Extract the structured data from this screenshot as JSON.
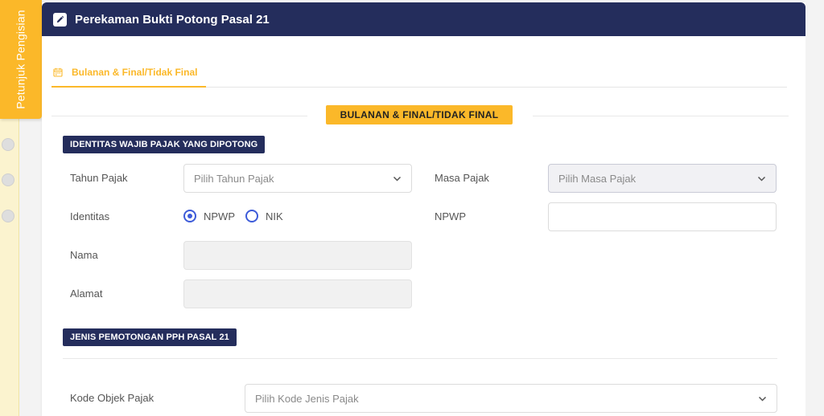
{
  "side_tab": {
    "label": "Petunjuk Pengisian"
  },
  "header": {
    "title": "Perekaman Bukti Potong Pasal 21"
  },
  "tabs": [
    {
      "label": "Bulanan & Final/Tidak Final",
      "active": true
    }
  ],
  "section": {
    "title": "BULANAN & FINAL/TIDAK FINAL"
  },
  "identitas_group": {
    "title": "IDENTITAS WAJIB PAJAK YANG DIPOTONG",
    "tahun_pajak": {
      "label": "Tahun Pajak",
      "placeholder": "Pilih Tahun Pajak"
    },
    "masa_pajak": {
      "label": "Masa Pajak",
      "placeholder": "Pilih Masa Pajak"
    },
    "identitas": {
      "label": "Identitas",
      "options": [
        "NPWP",
        "NIK"
      ],
      "selected": "NPWP"
    },
    "npwp": {
      "label": "NPWP",
      "value": ""
    },
    "nama": {
      "label": "Nama",
      "value": ""
    },
    "alamat": {
      "label": "Alamat",
      "value": ""
    }
  },
  "jenis_group": {
    "title": "JENIS PEMOTONGAN PPH PASAL 21",
    "kode_objek": {
      "label": "Kode Objek Pajak",
      "placeholder": "Pilih Kode Jenis Pajak"
    }
  },
  "colors": {
    "accent": "#fbb829",
    "header": "#242d5c",
    "radio": "#3d5bd9"
  }
}
